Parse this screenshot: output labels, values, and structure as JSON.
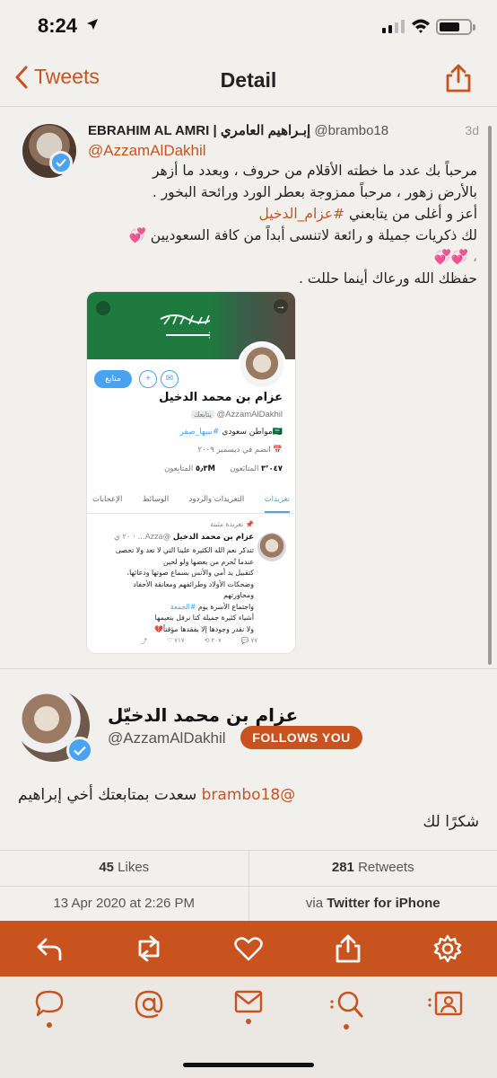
{
  "status_bar": {
    "time": "8:24"
  },
  "nav": {
    "back_label": "Tweets",
    "title": "Detail"
  },
  "tweet1": {
    "display_name": "EBRAHIM AL AMRI | إبـراهيم العامري",
    "handle": "@brambo18",
    "time_ago": "3d",
    "reply_to": "@AzzamAlDakhil",
    "lines": [
      "مرحباً بك عدد ما خطته الأقلام من حروف ، وبعدد ما أزهر",
      "بالأرض زهور ، مرحباً ممزوجة بعطر الورد ورائحة البخور .",
      "أعز و أغلى من يتابعني",
      "#عزام_الدخيل",
      "لك ذكريات جميلة و رائعة لاتنسى أبداً من كافة السعوديين",
      "💞",
      "، 💞💞",
      "حفظك الله ورعاك أينما حللت ."
    ]
  },
  "card": {
    "follow_label": "متابع",
    "name": "عزام بن محمد الدخيل",
    "handle": "@AzzamAlDakhil",
    "follows_you": "يتابعك",
    "bio_prefix": "🇸🇦مواطن سعودي",
    "bio_hashtag": "#نبيها_صفر",
    "joined": "انضم في ديسمبر ٢٠٠٩",
    "following_count": "٣٬٠٤٧",
    "following_label": "المتابَعون",
    "followers_count": "٥٫٣M",
    "followers_label": "المتابِعون",
    "tabs": [
      "تغريدات",
      "التغريدات والردود",
      "الوسائط",
      "الإعجابات"
    ],
    "pinned_label": "تغريدة مثبتة",
    "mini_name": "عزام بن محمد الدخيل",
    "mini_meta": "@Azza... · ٢٠ ي",
    "mini_lines": [
      "تتذكر نعم الله الكثيرة علينا التي لا تعد ولا تحصى",
      "عندما تُحرم من بعضها ولو لحين",
      "كتقبيل يد أمي والأنس بسماع صوتها ودعائها،",
      "وضحكات الأولاد وطرائفهم ومعانقة الأحفاد",
      "ومحاورتهم",
      "واجتماع الأسرة يوم",
      "#الجمعة",
      "أشياء كثيرة جميلة كنا نرفل بنعيمها",
      "ولا نقدر وجودها إلا يفقدها مؤقتاً💔"
    ],
    "mini_counts": {
      "replies": "٧٧",
      "retweets": "٢٠٧",
      "likes": "٧١٧"
    }
  },
  "tweet2": {
    "display_name": "عزام بن محمد الدخيّل",
    "handle": "@AzzamAlDakhil",
    "follows_badge": "FOLLOWS YOU",
    "mention": "@brambo18",
    "line1_text": " سعدت بمتابعتك أخي إبراهيم",
    "line2": "شكرًا لك"
  },
  "stats": {
    "likes_count": "45",
    "likes_label": " Likes",
    "retweets_count": "281",
    "retweets_label": " Retweets",
    "date": "13 Apr 2020 at 2:26 PM",
    "via_prefix": "via ",
    "via_source": "Twitter for iPhone"
  },
  "colors": {
    "accent": "#c8531f",
    "background": "#f2f0ec",
    "link_blue": "#4aa3f0"
  },
  "actions": [
    "reply-icon",
    "retweet-icon",
    "like-icon",
    "share-icon",
    "settings-icon"
  ],
  "tabs": [
    "timeline-icon",
    "mentions-icon",
    "messages-icon",
    "search-icon",
    "profile-icon"
  ]
}
